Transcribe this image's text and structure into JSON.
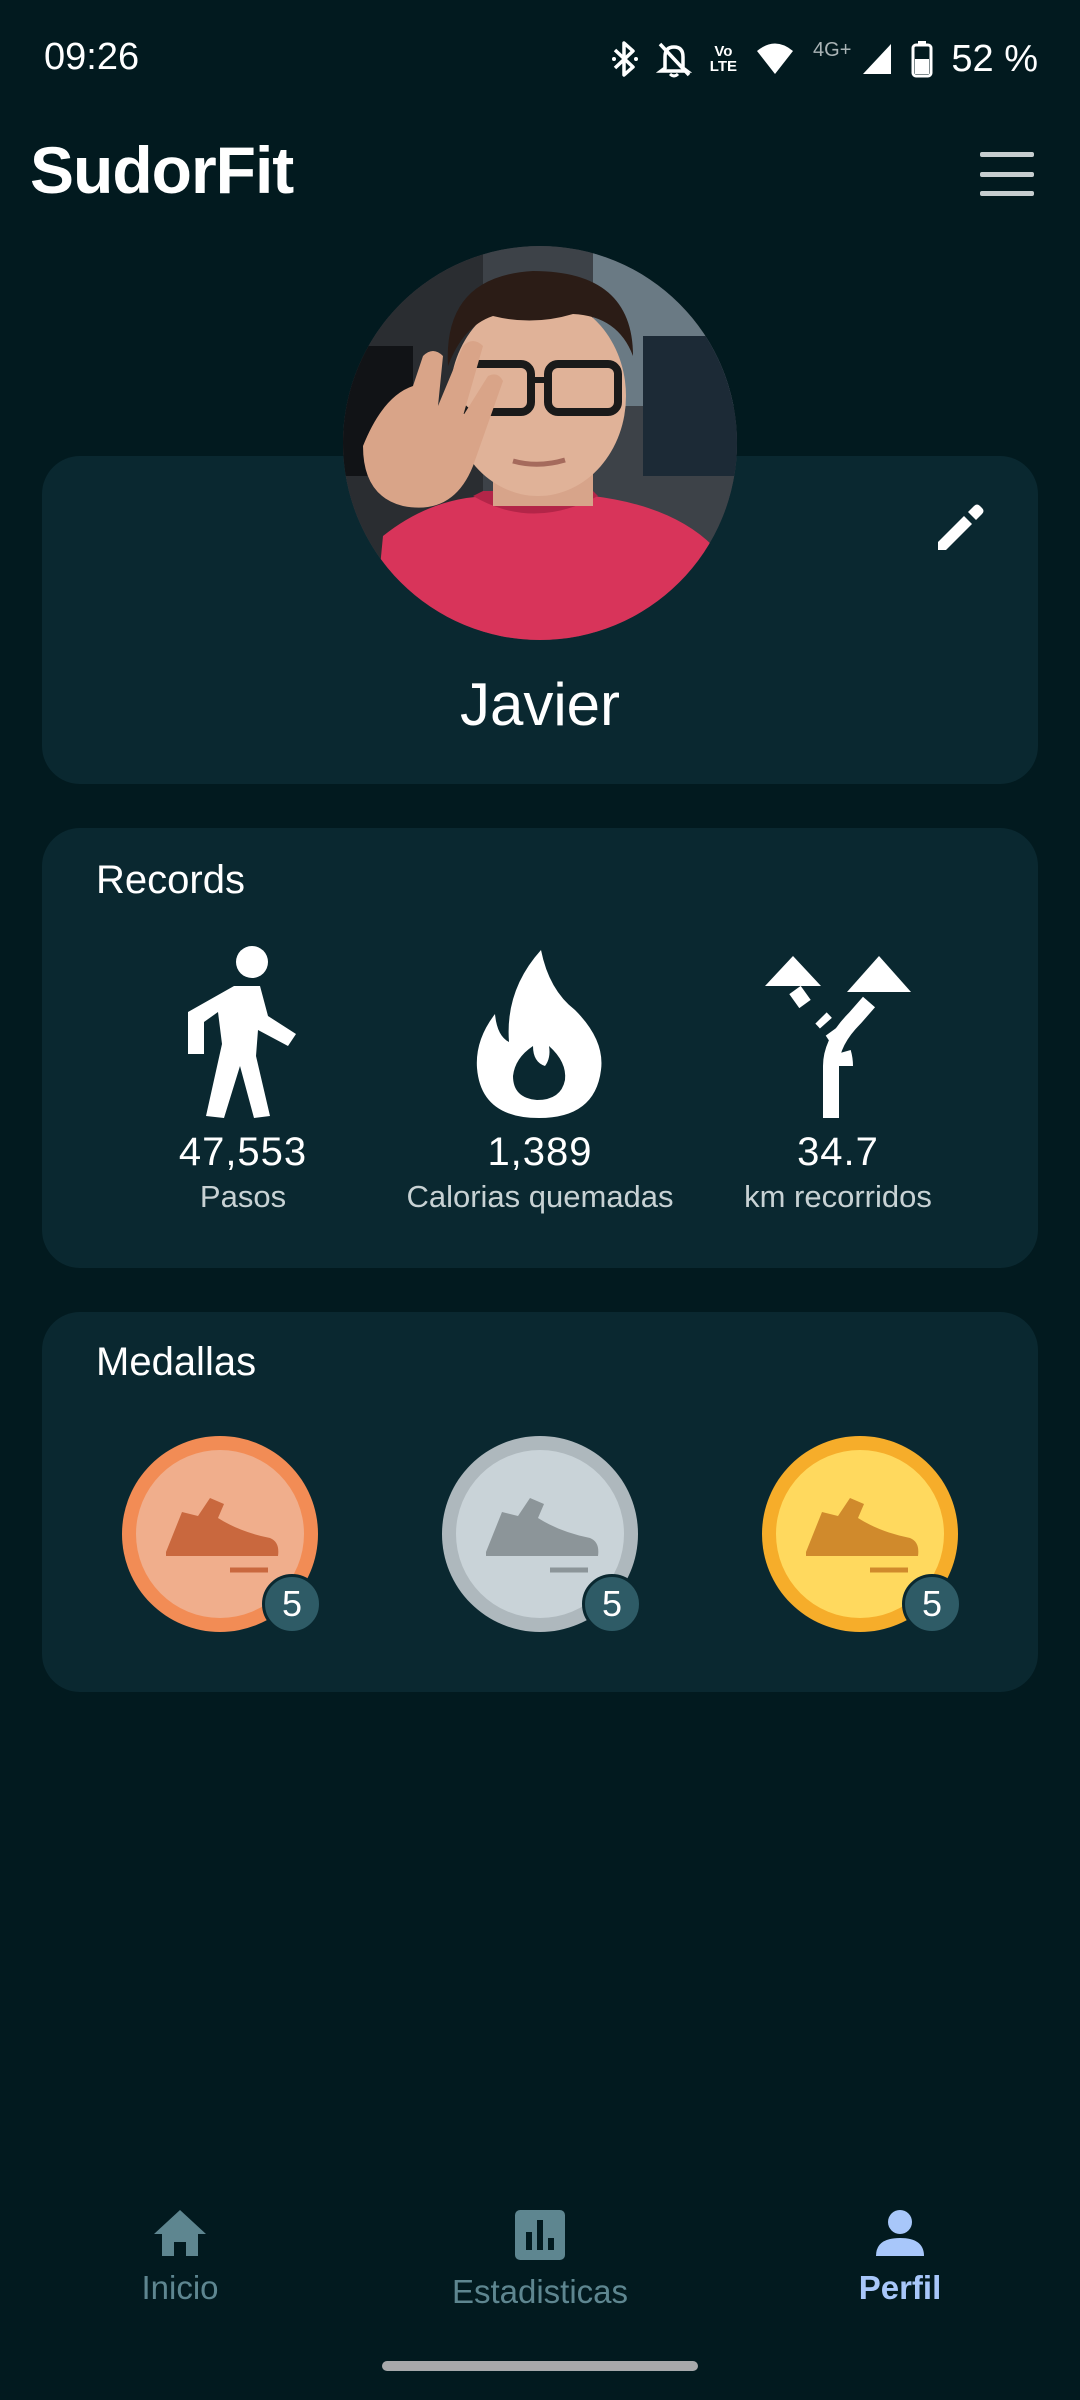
{
  "status_bar": {
    "time": "09:26",
    "lte_top": "Vo",
    "lte_bottom": "LTE",
    "network": "4G+",
    "battery": "52 %",
    "icons": [
      "bluetooth-icon",
      "do-not-disturb-icon",
      "volte-icon",
      "wifi-icon",
      "signal-icon",
      "battery-icon"
    ]
  },
  "app": {
    "title": "SudorFit",
    "menu_icon": "hamburger-menu-icon"
  },
  "profile": {
    "name": "Javier",
    "edit_icon": "pencil-icon"
  },
  "records": {
    "title": "Records",
    "items": [
      {
        "icon": "walking-person-icon",
        "value": "47,553",
        "label": "Pasos"
      },
      {
        "icon": "flame-icon",
        "value": "1,389",
        "label": "Calorias quemadas"
      },
      {
        "icon": "fork-arrows-icon",
        "value": "34.7",
        "label": "km recorridos"
      }
    ]
  },
  "medals": {
    "title": "Medallas",
    "items": [
      {
        "tier": "bronze",
        "icon": "sneaker-icon",
        "count": "5",
        "color": "#f0a276"
      },
      {
        "tier": "silver",
        "icon": "sneaker-icon",
        "count": "5",
        "color": "#c9d3d8"
      },
      {
        "tier": "gold",
        "icon": "sneaker-icon",
        "count": "5",
        "color": "#ffd95e"
      }
    ]
  },
  "nav": {
    "items": [
      {
        "label": "Inicio",
        "icon": "home-icon",
        "active": false
      },
      {
        "label": "Estadisticas",
        "icon": "bar-chart-icon",
        "active": false
      },
      {
        "label": "Perfil",
        "icon": "person-icon",
        "active": true
      }
    ]
  },
  "colors": {
    "background": "#021a1f",
    "card": "#0a2830",
    "nav_active": "#a8c7fa",
    "nav_inactive": "#5e8690"
  }
}
